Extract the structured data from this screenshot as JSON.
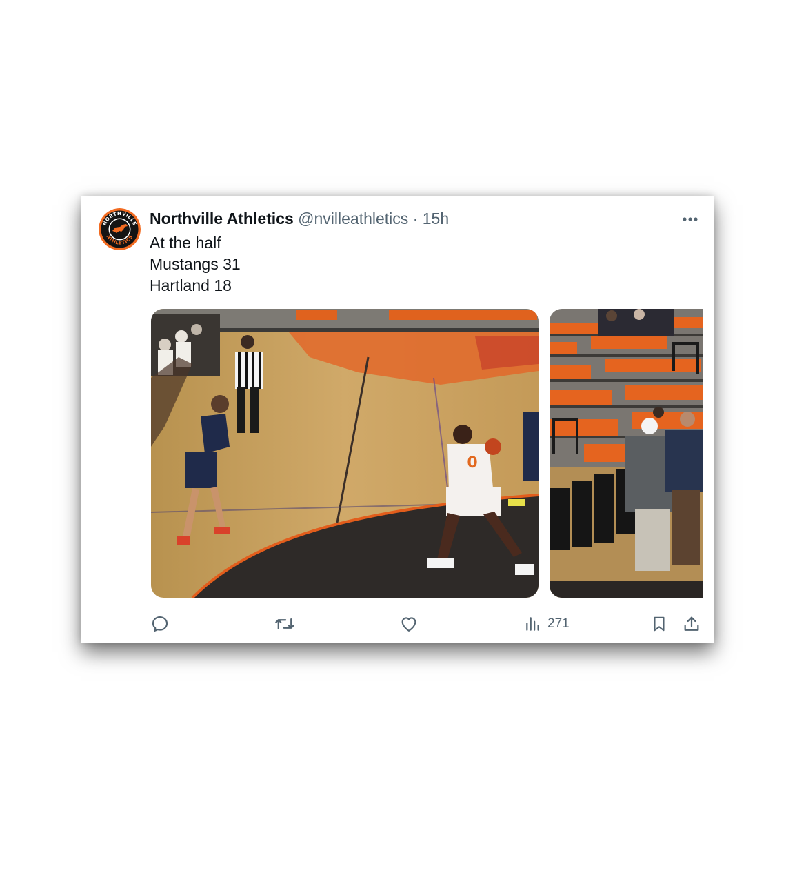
{
  "tweet": {
    "display_name": "Northville Athletics",
    "handle": "@nvilleathletics",
    "separator": "·",
    "time": "15h",
    "text_lines": [
      "At the half",
      "Mustangs 31",
      "Hartland 18"
    ],
    "avatar": {
      "ring_text_top": "NORTHVILLE",
      "ring_text_bottom": "ATHLETICS",
      "icon": "mustang-horse-logo"
    },
    "media": [
      {
        "icon": "basketball-game-photo",
        "jersey_number": "0"
      },
      {
        "icon": "bleachers-spectators-photo"
      }
    ],
    "actions": {
      "reply_icon": "reply-icon",
      "retweet_icon": "retweet-icon",
      "like_icon": "heart-icon",
      "views_icon": "views-chart-icon",
      "views_count": "271",
      "bookmark_icon": "bookmark-icon",
      "share_icon": "share-icon"
    },
    "colors": {
      "accent_orange": "#f26b21",
      "muted_text": "#536471",
      "primary_text": "#0f1419"
    }
  }
}
